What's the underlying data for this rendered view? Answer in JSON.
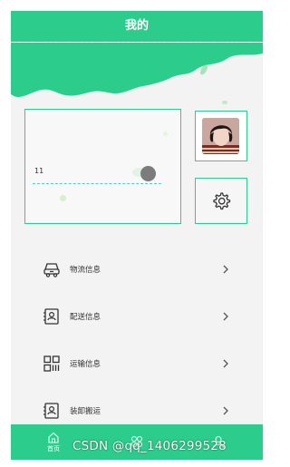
{
  "header": {
    "title": "我的"
  },
  "profile": {
    "id_text": "11"
  },
  "menu": {
    "items": [
      {
        "label": "物流信息",
        "icon": "truck-icon"
      },
      {
        "label": "配送信息",
        "icon": "id-card-icon"
      },
      {
        "label": "运输信息",
        "icon": "grid-icon"
      },
      {
        "label": "装卸搬运",
        "icon": "id-card-icon"
      }
    ]
  },
  "tabbar": {
    "home_label": "首页",
    "mid_label": "",
    "user_label": ""
  },
  "watermark": {
    "text": "CSDN @qq_1406299528"
  },
  "colors": {
    "accent": "#2ccc8c",
    "background": "#f3f3f3",
    "knob": "#7c7c7c"
  }
}
